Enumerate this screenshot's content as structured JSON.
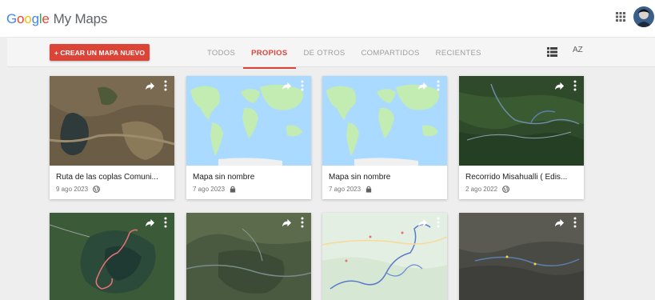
{
  "header": {
    "logo": [
      "G",
      "o",
      "o",
      "g",
      "l",
      "e"
    ],
    "product": "My Maps",
    "icons": {
      "apps": "apps-grid-icon",
      "account": "avatar"
    }
  },
  "toolbar": {
    "create_label": "+ CREAR UN MAPA NUEVO",
    "tabs": [
      {
        "label": "TODOS",
        "active": false
      },
      {
        "label": "PROPIOS",
        "active": true
      },
      {
        "label": "DE OTROS",
        "active": false
      },
      {
        "label": "COMPARTIDOS",
        "active": false
      },
      {
        "label": "RECIENTES",
        "active": false
      }
    ],
    "sort_label": "AZ",
    "icons": {
      "list": "list-view-icon",
      "sort": "sort-az-icon"
    }
  },
  "colors": {
    "accent": "#db4437",
    "background": "#eeeeee",
    "card": "#ffffff"
  },
  "maps": [
    {
      "title": "Ruta de las coplas Comuni...",
      "date": "9 ago 2023",
      "visibility_icon": "globe-icon"
    },
    {
      "title": "Mapa sin nombre",
      "date": "7 ago 2023",
      "visibility_icon": "lock-icon"
    },
    {
      "title": "Mapa sin nombre",
      "date": "7 ago 2023",
      "visibility_icon": "lock-icon"
    },
    {
      "title": "Recorrido Misahualli ( Edis...",
      "date": "2 ago 2022",
      "visibility_icon": "globe-icon"
    }
  ]
}
